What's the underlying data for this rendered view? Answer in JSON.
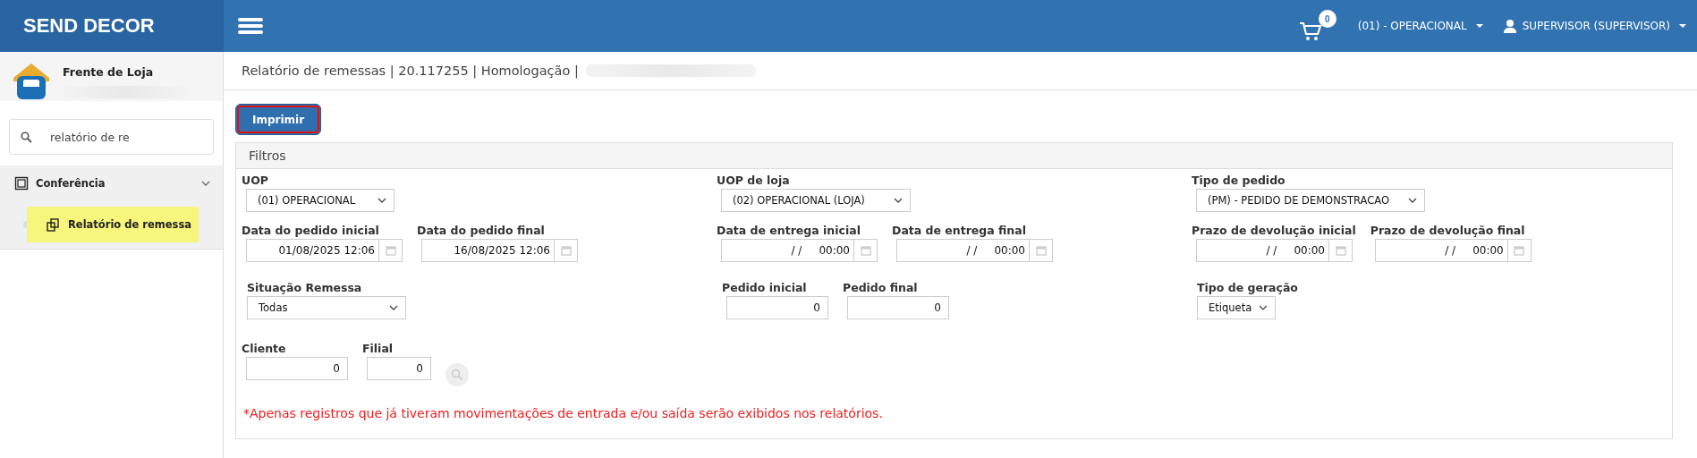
{
  "app": {
    "title": "SEND DECOR"
  },
  "header": {
    "cart_count": "0",
    "unit": "(01) - OPERACIONAL",
    "user": "SUPERVISOR (SUPERVISOR)"
  },
  "sidebar": {
    "module": "Frente de Loja",
    "search": {
      "value": "relatório de re"
    },
    "items": [
      {
        "label": "Conferência",
        "expanded": true,
        "children": [
          {
            "label": "Relatório de remessa",
            "selected": true
          }
        ]
      }
    ]
  },
  "page": {
    "title": "Relatório de remessas | 20.117255 | Homologação |"
  },
  "print_button": {
    "label": "Imprimir",
    "highlighted": true
  },
  "filters": {
    "title": "Filtros",
    "rows": [
      [
        [
          {
            "kind": "select",
            "label": "UOP",
            "value": "(01) OPERACIONAL"
          }
        ],
        [
          {
            "kind": "select",
            "label": "UOP de loja",
            "value": "(02) OPERACIONAL (LOJA)"
          }
        ],
        [
          {
            "kind": "select",
            "label": "Tipo de pedido",
            "value": "(PM) - PEDIDO DE DEMONSTRACAO"
          }
        ]
      ],
      [
        [
          {
            "kind": "datetime",
            "label": "Data do pedido inicial",
            "value": "01/08/2025 12:06"
          },
          {
            "kind": "datetime",
            "label": "Data do pedido final",
            "value": "16/08/2025 12:06"
          }
        ],
        [
          {
            "kind": "datetime",
            "label": "Data de entrega inicial",
            "value": "/ /     00:00"
          },
          {
            "kind": "datetime",
            "label": "Data de entrega final",
            "value": "/ /     00:00"
          }
        ],
        [
          {
            "kind": "datetime",
            "label": "Prazo de devolução inicial",
            "value": "/ /     00:00"
          },
          {
            "kind": "datetime",
            "label": "Prazo de devolução final",
            "value": "/ /     00:00"
          }
        ]
      ],
      [
        [
          {
            "kind": "select",
            "label": "Situação Remessa",
            "value": "Todas"
          }
        ],
        [
          {
            "kind": "number",
            "label": "Pedido inicial",
            "value": "0"
          },
          {
            "kind": "number",
            "label": "Pedido final",
            "value": "0"
          }
        ],
        [
          {
            "kind": "select",
            "label": "Tipo de geração",
            "value": "Etiqueta"
          }
        ]
      ],
      [
        [
          {
            "kind": "number",
            "label": "Cliente",
            "value": "0"
          },
          {
            "kind": "number",
            "label": "Filial",
            "value": "0"
          },
          {
            "kind": "search_button"
          }
        ],
        [],
        []
      ]
    ],
    "note": "*Apenas registros que já tiveram movimentações de entrada e/ou saída serão exibidos nos relatórios."
  }
}
